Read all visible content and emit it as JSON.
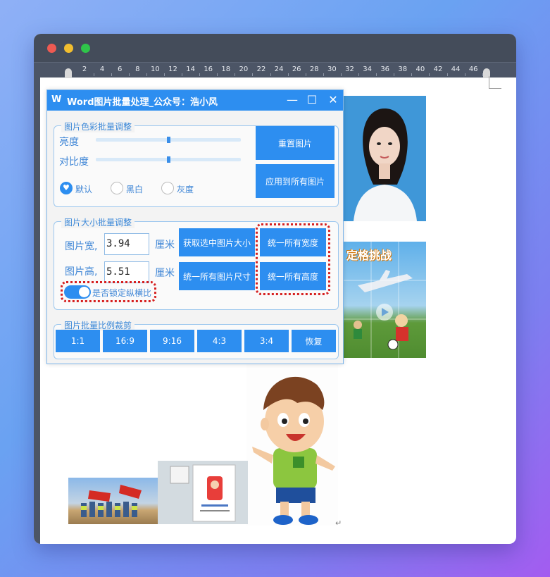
{
  "ruler": {
    "ticks": [
      "2",
      "4",
      "6",
      "8",
      "10",
      "12",
      "14",
      "16",
      "18",
      "20",
      "22",
      "24",
      "26",
      "28",
      "30",
      "32",
      "34",
      "36",
      "38",
      "40",
      "42",
      "44",
      "46"
    ]
  },
  "dialog": {
    "icon_label": "W",
    "title": "Word图片批量处理_公众号：浩小风",
    "controls": {
      "minimize": "—",
      "maximize": "☐",
      "close": "✕"
    },
    "color_group": {
      "legend": "图片色彩批量调整",
      "brightness_label": "亮度",
      "brightness_value": 0.5,
      "contrast_label": "对比度",
      "contrast_value": 0.5,
      "reset_button": "重置图片",
      "apply_all_button": "应用到所有图片",
      "modes": [
        {
          "label": "默认",
          "selected": true
        },
        {
          "label": "黑白",
          "selected": false
        },
        {
          "label": "灰度",
          "selected": false
        }
      ]
    },
    "size_group": {
      "legend": "图片大小批量调整",
      "width_label": "图片宽,",
      "width_value": "3.94",
      "height_label": "图片高,",
      "height_value": "5.51",
      "unit_label": "厘米",
      "get_size_button": "获取选中图片大小",
      "unify_size_button": "统一所有图片尺寸",
      "unify_width_button": "统一所有宽度",
      "unify_height_button": "统一所有高度",
      "lock_ratio_label": "是否锁定纵横比",
      "lock_ratio_on": true
    },
    "crop_group": {
      "legend": "图片批量比例裁剪",
      "ratios": [
        "1:1",
        "16:9",
        "9:16",
        "4:3",
        "3:4",
        "恢复"
      ]
    }
  },
  "document": {
    "soccer_banner": "定格挑战",
    "return_mark": "↵"
  },
  "colors": {
    "accent": "#2d8ef0",
    "highlight": "#d62020",
    "titlebar": "#444c5a"
  }
}
